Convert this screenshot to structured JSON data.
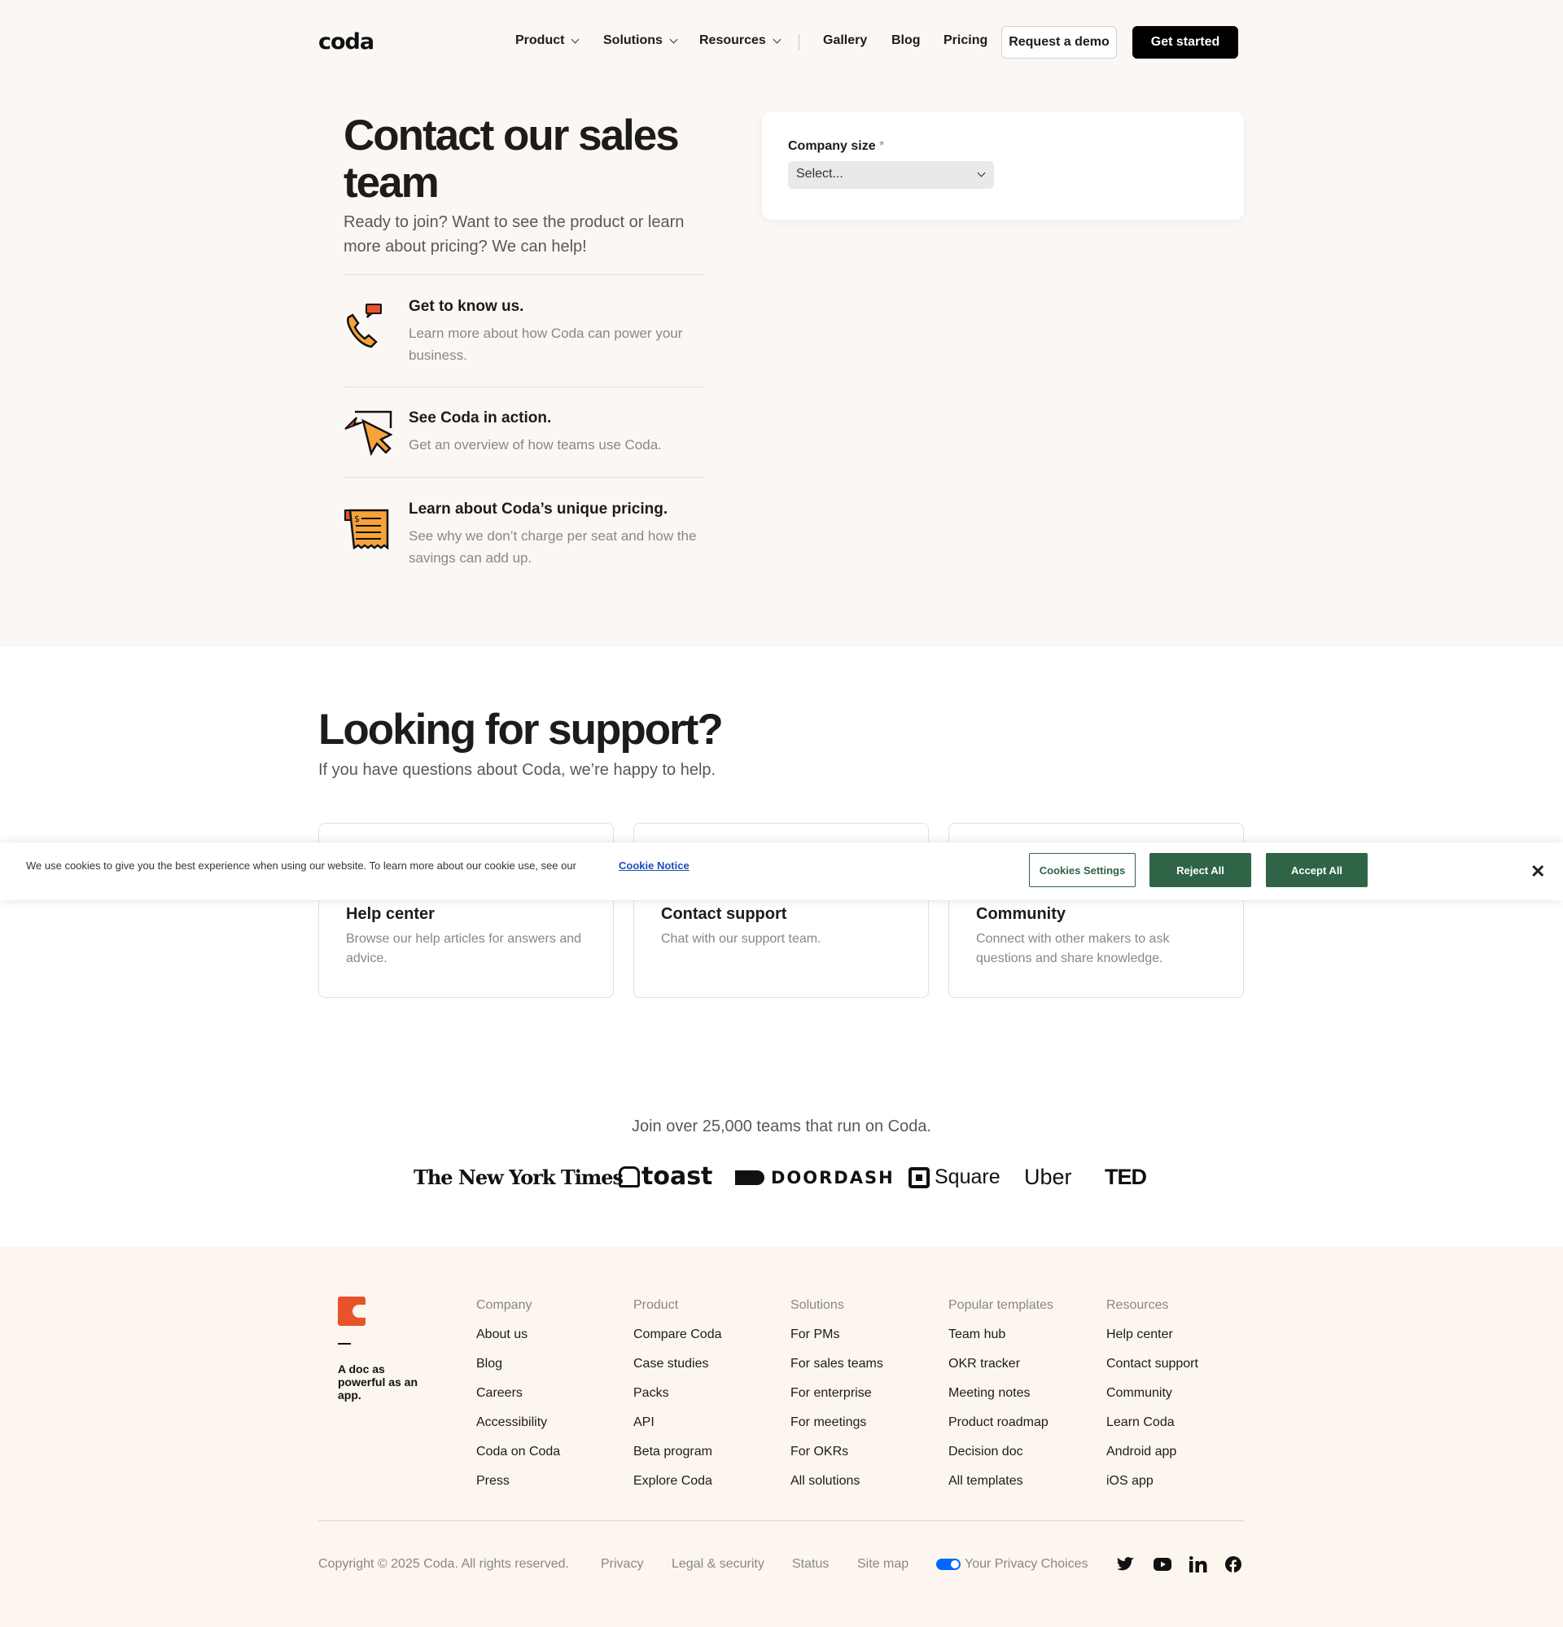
{
  "nav": {
    "logo": "coda",
    "items": [
      {
        "label": "Product",
        "dropdown": true
      },
      {
        "label": "Solutions",
        "dropdown": true
      },
      {
        "label": "Resources",
        "dropdown": true
      },
      {
        "label": "Gallery",
        "dropdown": false
      },
      {
        "label": "Blog",
        "dropdown": false
      },
      {
        "label": "Pricing",
        "dropdown": false
      }
    ],
    "demo_label": "Request a demo",
    "start_label": "Get started"
  },
  "hero": {
    "title": "Contact our sales team",
    "subtitle": "Ready to join? Want to see the product or learn more about pricing? We can help!",
    "features": [
      {
        "title": "Get to know us.",
        "desc": "Learn more about how Coda can power your business.",
        "icon": "phone-icon"
      },
      {
        "title": "See Coda in action.",
        "desc": "Get an overview of how teams use Coda.",
        "icon": "cursor-icon"
      },
      {
        "title": "Learn about Coda’s unique pricing.",
        "desc": "See why we don’t charge per seat and how the savings can add up.",
        "icon": "receipt-icon"
      }
    ]
  },
  "form": {
    "label": "Company size",
    "required_mark": "*",
    "select_value": "Select..."
  },
  "support": {
    "title": "Looking for support?",
    "subtitle": "If you have questions about Coda, we’re happy to help.",
    "cards": [
      {
        "title": "Help center",
        "desc": "Browse our help articles for answers and advice."
      },
      {
        "title": "Contact support",
        "desc": "Chat with our support team."
      },
      {
        "title": "Community",
        "desc": "Connect with other makers to ask questions and share knowledge."
      }
    ]
  },
  "cookie": {
    "text": "We use cookies to give you the best experience when using our website. To learn more about our cookie use, see our",
    "link": "Cookie Notice",
    "settings": "Cookies Settings",
    "reject": "Reject All",
    "accept": "Accept All",
    "close": "✕"
  },
  "logos": {
    "headline": "Join over 25,000 teams that run on Coda.",
    "brands": [
      "The New York Times",
      "toast",
      "DOORDASH",
      "Square",
      "Uber",
      "TED"
    ]
  },
  "footer": {
    "tagline": "A doc as powerful as an app.",
    "columns": [
      {
        "heading": "Company",
        "links": [
          "About us",
          "Blog",
          "Careers",
          "Accessibility",
          "Coda on Coda",
          "Press"
        ]
      },
      {
        "heading": "Product",
        "links": [
          "Compare Coda",
          "Case studies",
          "Packs",
          "API",
          "Beta program",
          "Explore Coda"
        ]
      },
      {
        "heading": "Solutions",
        "links": [
          "For PMs",
          "For sales teams",
          "For enterprise",
          "For meetings",
          "For OKRs",
          "All solutions"
        ]
      },
      {
        "heading": "Popular templates",
        "links": [
          "Team hub",
          "OKR tracker",
          "Meeting notes",
          "Product roadmap",
          "Decision doc",
          "All templates"
        ]
      },
      {
        "heading": "Resources",
        "links": [
          "Help center",
          "Contact support",
          "Community",
          "Learn Coda",
          "Android app",
          "iOS app"
        ]
      }
    ],
    "copyright": "Copyright © 2025 Coda. All rights reserved.",
    "bottom_links": [
      "Privacy",
      "Legal & security",
      "Status",
      "Site map"
    ],
    "privacy_choices": "Your Privacy Choices",
    "social": [
      "twitter-icon",
      "youtube-icon",
      "linkedin-icon",
      "facebook-icon"
    ]
  }
}
